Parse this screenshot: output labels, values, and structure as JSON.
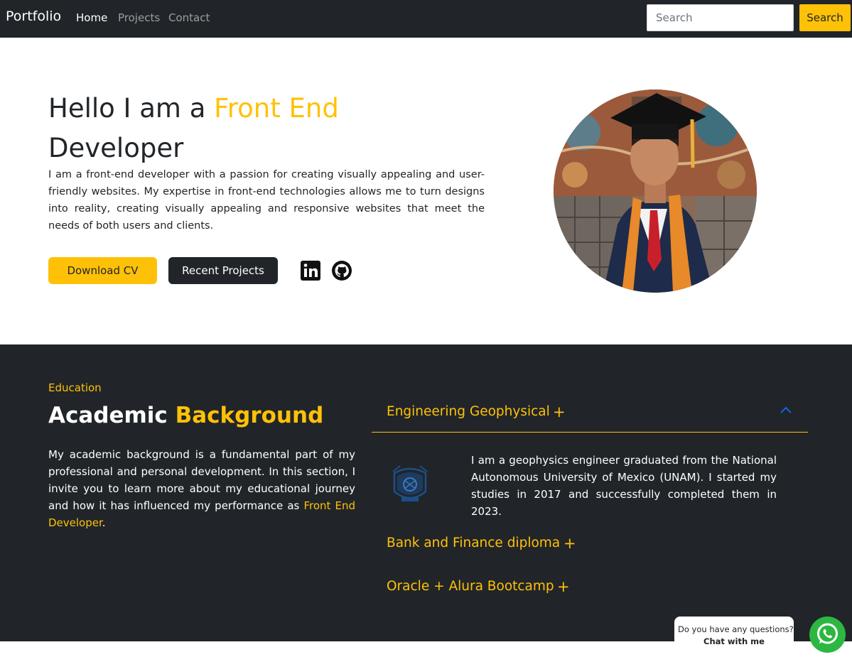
{
  "navbar": {
    "brand": "Portfolio",
    "links": [
      {
        "label": "Home",
        "active": true
      },
      {
        "label": "Projects",
        "active": false
      },
      {
        "label": "Contact",
        "active": false
      }
    ],
    "search_placeholder": "Search",
    "search_button": "Search"
  },
  "hero": {
    "title_prefix": "Hello I am a ",
    "title_accent": "Front End",
    "title_suffix": "Developer",
    "description": "I am a front-end developer with a passion for creating visually appealing and user-friendly websites. My expertise in front-end technologies allows me to turn designs into reality, creating visually appealing and responsive websites that meet the needs of both users and clients.",
    "download_cv": "Download CV",
    "recent_projects": "Recent Projects",
    "social_icons": [
      "linkedin-icon",
      "github-icon"
    ]
  },
  "education": {
    "eyebrow": "Education",
    "title_prefix": "Academic ",
    "title_accent": "Background",
    "description_main": "My academic background is a fundamental part of my professional and personal development. In this section, I invite you to learn more about my educational journey and how it has influenced my performance as ",
    "description_accent": "Front End Developer",
    "description_end": ".",
    "accordion": [
      {
        "title": "Engineering Geophysical",
        "toggle": "+",
        "expanded": true,
        "body": "I am a geophysics engineer graduated from the National Autonomous University of Mexico (UNAM). I started my studies in 2017 and successfully completed them in 2023."
      },
      {
        "title": "Bank and Finance diploma",
        "toggle": "+",
        "expanded": false
      },
      {
        "title": "Oracle + Alura Bootcamp",
        "toggle": "+",
        "expanded": false
      }
    ]
  },
  "chat": {
    "question": "Do you have any questions?",
    "cta": "Chat with me"
  },
  "colors": {
    "accent": "#ffc107",
    "dark": "#212529",
    "whatsapp": "#2db742",
    "chevron": "#0d6efd"
  }
}
